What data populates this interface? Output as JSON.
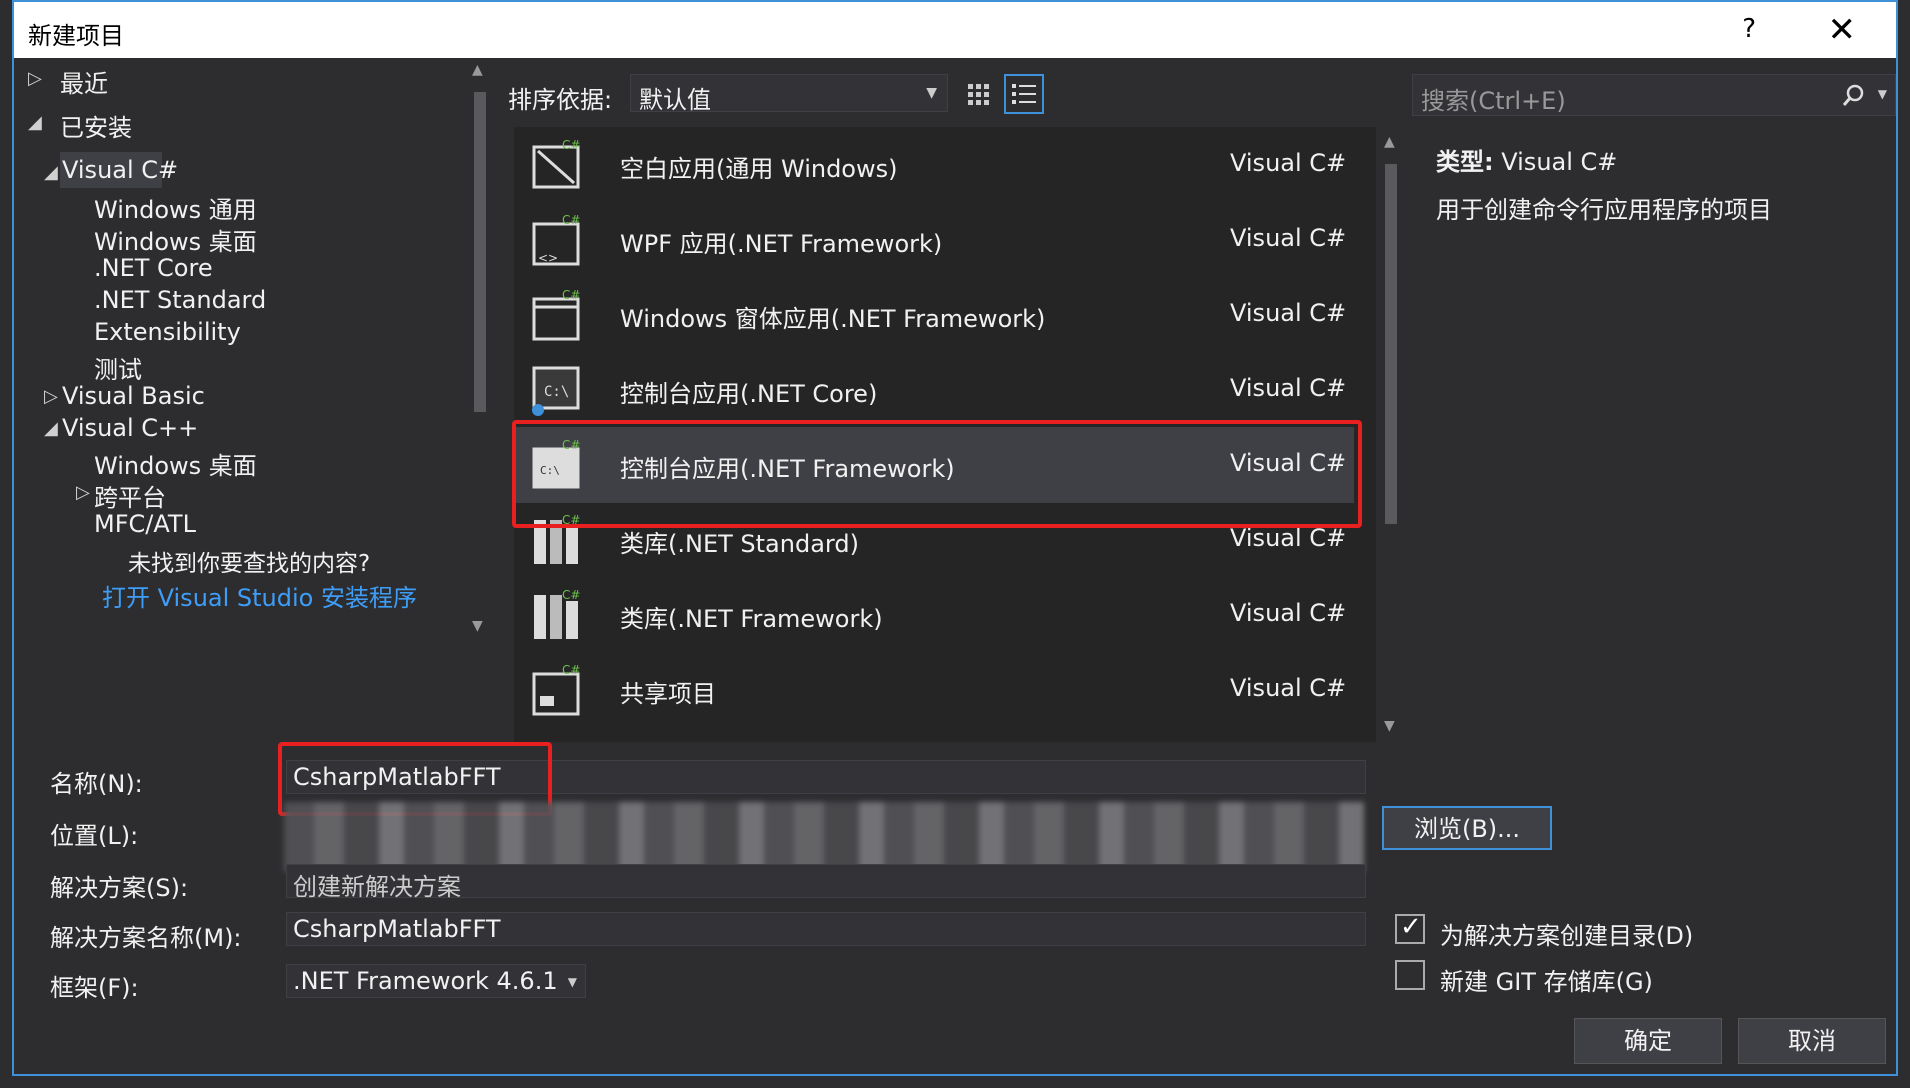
{
  "window": {
    "title": "新建项目",
    "help_label": "?",
    "close_label": "✕"
  },
  "tree": {
    "recent": "最近",
    "installed": "已安装",
    "visual_csharp": "Visual C#",
    "csharp_children": [
      "Windows 通用",
      "Windows 桌面",
      ".NET Core",
      ".NET Standard",
      "Extensibility",
      "测试"
    ],
    "visual_basic": "Visual Basic",
    "visual_cpp": "Visual C++",
    "cpp_children": [
      "Windows 桌面",
      "跨平台",
      "MFC/ATL"
    ],
    "not_found": "未找到你要查找的内容?",
    "open_installer": "打开 Visual Studio 安装程序"
  },
  "toolbar": {
    "sort_label": "排序依据:",
    "sort_value": "默认值"
  },
  "templates": [
    {
      "name": "空白应用(通用 Windows)",
      "lang": "Visual C#"
    },
    {
      "name": "WPF 应用(.NET Framework)",
      "lang": "Visual C#"
    },
    {
      "name": "Windows 窗体应用(.NET Framework)",
      "lang": "Visual C#"
    },
    {
      "name": "控制台应用(.NET Core)",
      "lang": "Visual C#"
    },
    {
      "name": "控制台应用(.NET Framework)",
      "lang": "Visual C#",
      "selected": true
    },
    {
      "name": "类库(.NET Standard)",
      "lang": "Visual C#"
    },
    {
      "name": "类库(.NET Framework)",
      "lang": "Visual C#"
    },
    {
      "name": "共享项目",
      "lang": "Visual C#"
    }
  ],
  "search": {
    "placeholder": "搜索(Ctrl+E)"
  },
  "description": {
    "type_label": "类型:",
    "type_value": "Visual C#",
    "text": "用于创建命令行应用程序的项目"
  },
  "form": {
    "name_label": "名称(N):",
    "name_value": "CsharpMatlabFFT",
    "location_label": "位置(L):",
    "solution_label": "解决方案(S):",
    "solution_value": "创建新解决方案",
    "solution_name_label": "解决方案名称(M):",
    "solution_name_value": "CsharpMatlabFFT",
    "framework_label": "框架(F):",
    "framework_value": ".NET Framework 4.6.1",
    "browse_label": "浏览(B)...",
    "create_dir_label": "为解决方案创建目录(D)",
    "create_dir_checked": true,
    "new_git_label": "新建 GIT 存储库(G)",
    "new_git_checked": false,
    "ok_label": "确定",
    "cancel_label": "取消"
  },
  "colors": {
    "accent": "#3e90d8",
    "highlight_box": "#e82020",
    "link": "#3e9ef7"
  }
}
